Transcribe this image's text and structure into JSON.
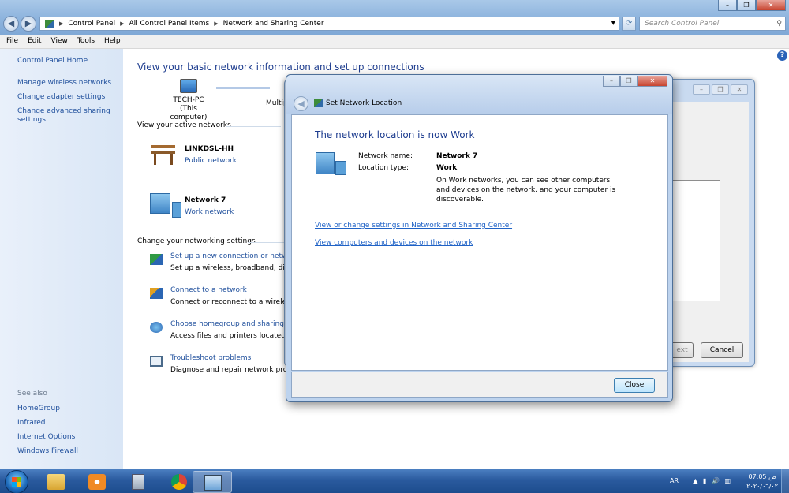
{
  "window": {
    "breadcrumb": [
      "Control Panel",
      "All Control Panel Items",
      "Network and Sharing Center"
    ],
    "search_placeholder": "Search Control Panel"
  },
  "menu": [
    "File",
    "Edit",
    "View",
    "Tools",
    "Help"
  ],
  "sidebar": {
    "home": "Control Panel Home",
    "items": [
      "Manage wireless networks",
      "Change adapter settings",
      "Change advanced sharing settings"
    ],
    "see_also_title": "See also",
    "see_also": [
      "HomeGroup",
      "Infrared",
      "Internet Options",
      "Windows Firewall"
    ]
  },
  "main": {
    "heading": "View your basic network information and set up connections",
    "computer_name": "TECH-PC",
    "computer_sub": "(This computer)",
    "multiple": "Multip",
    "active_networks_label": "View your active networks",
    "networks": [
      {
        "name": "LINKDSL-HH",
        "type": "Public network",
        "icon": "park-bench-icon"
      },
      {
        "name": "Network  7",
        "type": "Work network",
        "icon": "office-building-icon"
      }
    ],
    "change_settings_label": "Change your networking settings",
    "tasks": [
      {
        "title": "Set up a new connection or network",
        "desc": "Set up a wireless, broadband, dial-u",
        "icon": "setup-connection-icon"
      },
      {
        "title": "Connect to a network",
        "desc": "Connect or reconnect to a wireless,",
        "icon": "connect-network-icon"
      },
      {
        "title": "Choose homegroup and sharing op",
        "desc": "Access files and printers located on",
        "icon": "homegroup-icon"
      },
      {
        "title": "Troubleshoot problems",
        "desc": "Diagnose and repair network proble",
        "icon": "troubleshoot-icon"
      }
    ]
  },
  "wizard": {
    "next_label": "ext",
    "cancel_label": "Cancel"
  },
  "dialog": {
    "title": "Set Network Location",
    "heading": "The network location is now Work",
    "network_name_label": "Network name:",
    "network_name_value": "Network  7",
    "location_type_label": "Location type:",
    "location_type_value": "Work",
    "description": "On Work networks, you can see other computers and devices on the network, and your computer is discoverable.",
    "link_settings": "View or change settings in Network and Sharing Center",
    "link_computers": "View computers and devices on the network",
    "close_label": "Close"
  },
  "taskbar": {
    "apps": [
      "windows-explorer-icon",
      "media-player-icon",
      "calculator-icon",
      "chrome-icon",
      "network-control-panel-icon"
    ],
    "language": "AR",
    "time": "07:05 ص",
    "date": "٢٠٢٠/٠٦/٠٢"
  },
  "colors": {
    "link": "#1f4f9c",
    "heading": "#1e3d8f",
    "taskbar": "#2a5a9e"
  }
}
